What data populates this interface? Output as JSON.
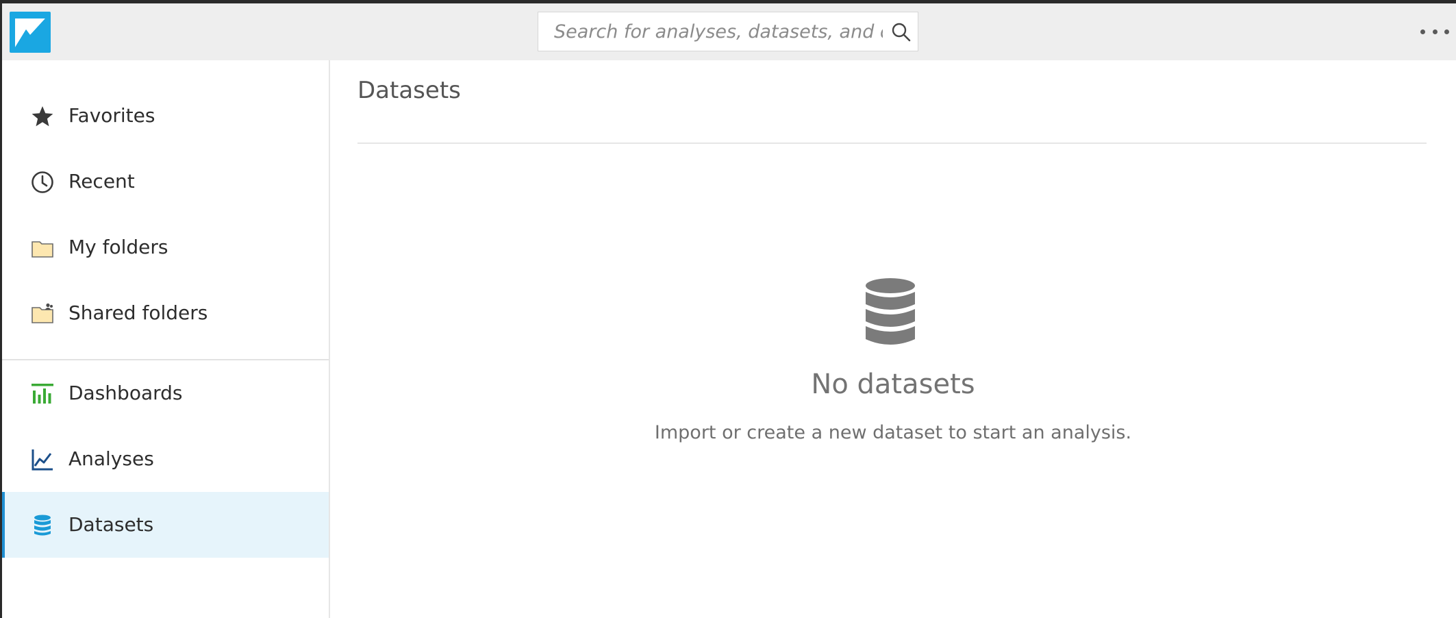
{
  "app": {
    "logo_icon": "quicksight-logo-icon",
    "brand_color": "#1aa7e2"
  },
  "search": {
    "placeholder": "Search for analyses, datasets, and das",
    "value": ""
  },
  "header": {
    "more_icon": "more-horizontal-icon"
  },
  "sidebar": {
    "items": [
      {
        "label": "Favorites",
        "icon": "star-icon"
      },
      {
        "label": "Recent",
        "icon": "clock-icon"
      },
      {
        "label": "My folders",
        "icon": "folder-icon"
      },
      {
        "label": "Shared folders",
        "icon": "shared-folder-icon"
      },
      {
        "label": "Dashboards",
        "icon": "dashboard-icon",
        "color": "#3aaa35"
      },
      {
        "label": "Analyses",
        "icon": "analysis-chart-icon",
        "color": "#1b4f8a"
      },
      {
        "label": "Datasets",
        "icon": "database-icon",
        "color": "#1a9ad6",
        "active": true
      }
    ]
  },
  "main": {
    "title": "Datasets",
    "empty_state": {
      "icon": "database-icon",
      "title": "No datasets",
      "message": "Import or create a new dataset to start an analysis."
    }
  }
}
